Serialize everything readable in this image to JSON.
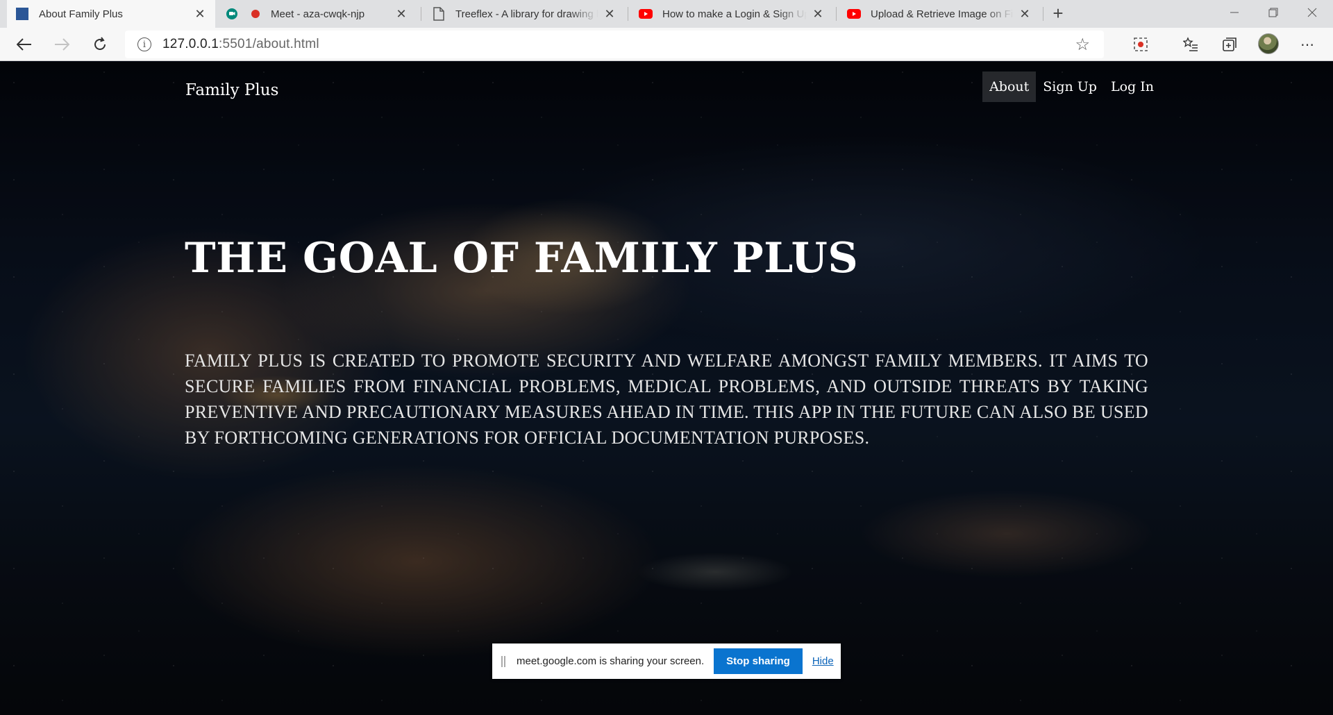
{
  "browser": {
    "tabs": [
      {
        "title": "About Family Plus",
        "favicon": "page-favicon-blue",
        "active": true
      },
      {
        "title": "Meet - aza-cwqk-njp",
        "favicon": "meet-icon",
        "recording": true
      },
      {
        "title": "Treeflex - A library for drawing h",
        "favicon": "document-icon"
      },
      {
        "title": "How to make a Login & Sign Up",
        "favicon": "youtube-icon"
      },
      {
        "title": "Upload & Retrieve Image on Fire",
        "favicon": "youtube-icon"
      }
    ],
    "url": {
      "host": "127.0.0.1",
      "rest": ":5501/about.html"
    }
  },
  "site": {
    "brand": "Family Plus",
    "nav": [
      {
        "label": "About",
        "active": true
      },
      {
        "label": "Sign Up"
      },
      {
        "label": "Log In"
      }
    ],
    "hero_title": "THE GOAL OF FAMILY PLUS",
    "hero_text": "Family Plus is created to promote security and welfare amongst family members. It aims to secure families from financial problems, medical problems, and outside threats by taking preventive and precautionary measures ahead in time. This app in the future can also be used by forthcoming generations for official documentation purposes."
  },
  "sharing_bar": {
    "message": "meet.google.com is sharing your screen.",
    "stop_label": "Stop sharing",
    "hide_label": "Hide"
  },
  "colors": {
    "tab_active": "#f7f7f7",
    "tab_strip": "#dfe0e2",
    "stop_button": "#0a74cf",
    "youtube_red": "#ff0000",
    "meet_green": "#00897b",
    "recording_red": "#d93025"
  }
}
